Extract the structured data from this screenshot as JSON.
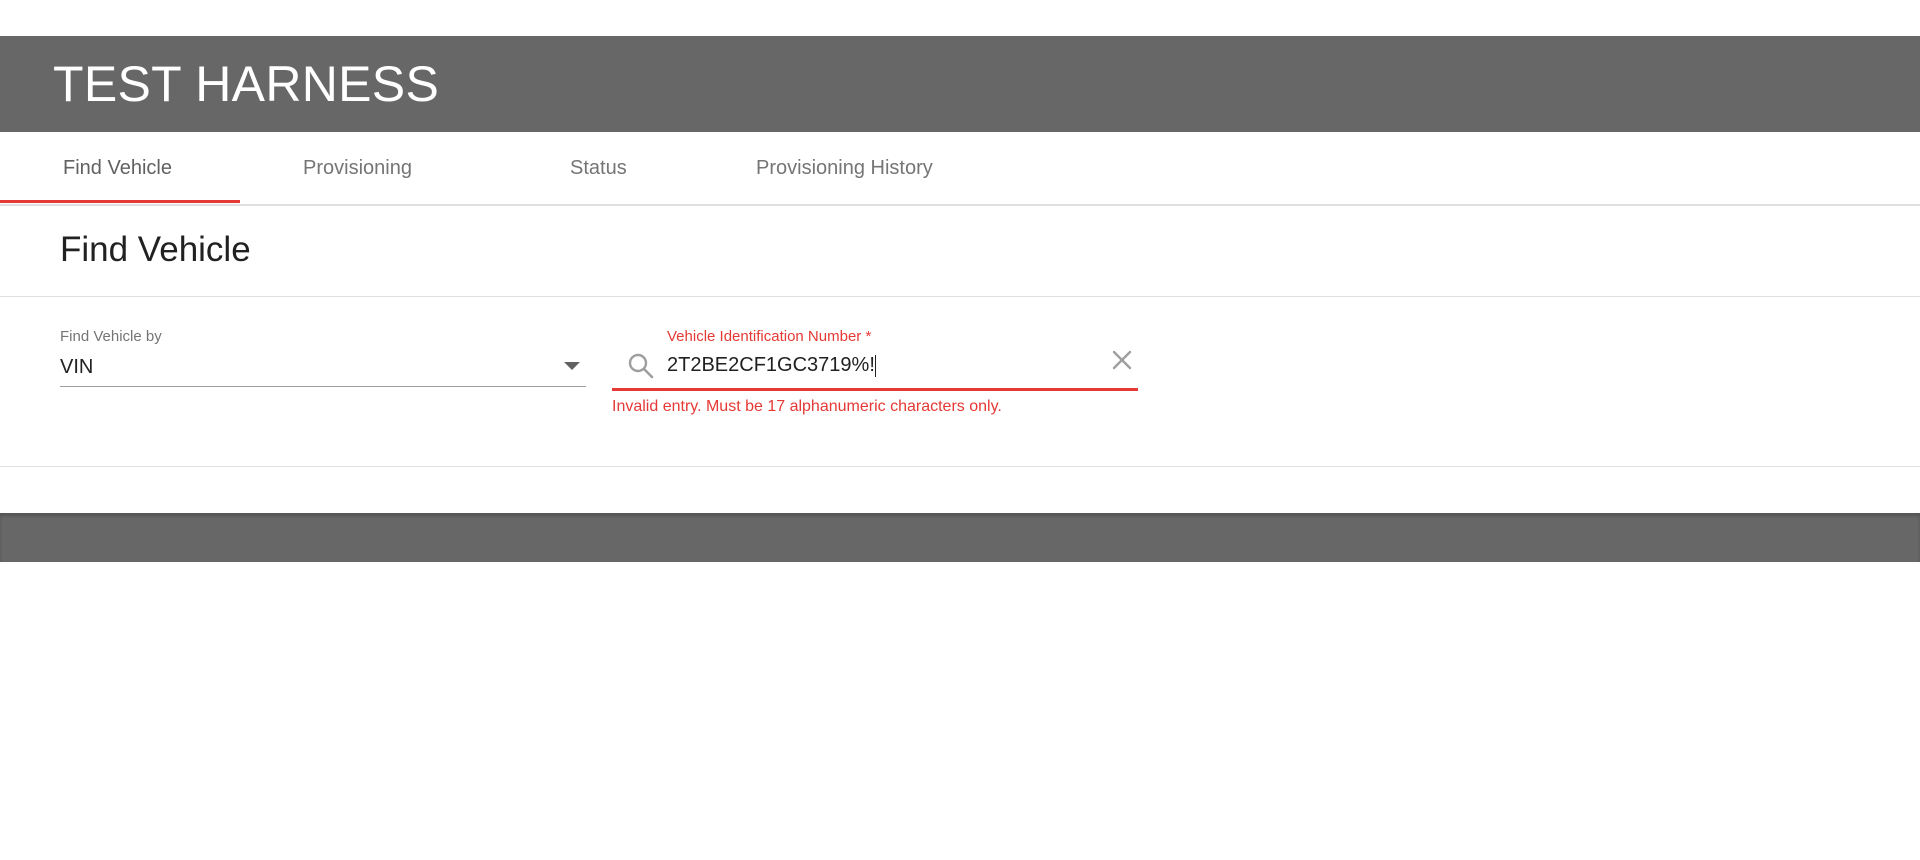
{
  "app": {
    "title": "TEST HARNESS"
  },
  "tabs": [
    {
      "label": "Find Vehicle",
      "active": true
    },
    {
      "label": "Provisioning",
      "active": false
    },
    {
      "label": "Status",
      "active": false
    },
    {
      "label": "Provisioning History",
      "active": false
    }
  ],
  "main": {
    "title": "Find Vehicle",
    "find_by": {
      "label": "Find Vehicle by",
      "value": "VIN"
    },
    "vin": {
      "label": "Vehicle Identification Number *",
      "value": "2T2BE2CF1GC3719%!",
      "error": "Invalid entry. Must be 17 alphanumeric characters only."
    }
  },
  "icons": {
    "search": "search-icon",
    "clear": "close-icon",
    "dropdown": "chevron-down-icon"
  },
  "colors": {
    "header_bg": "#676767",
    "accent": "#e53935",
    "tab_text": "#757575"
  }
}
